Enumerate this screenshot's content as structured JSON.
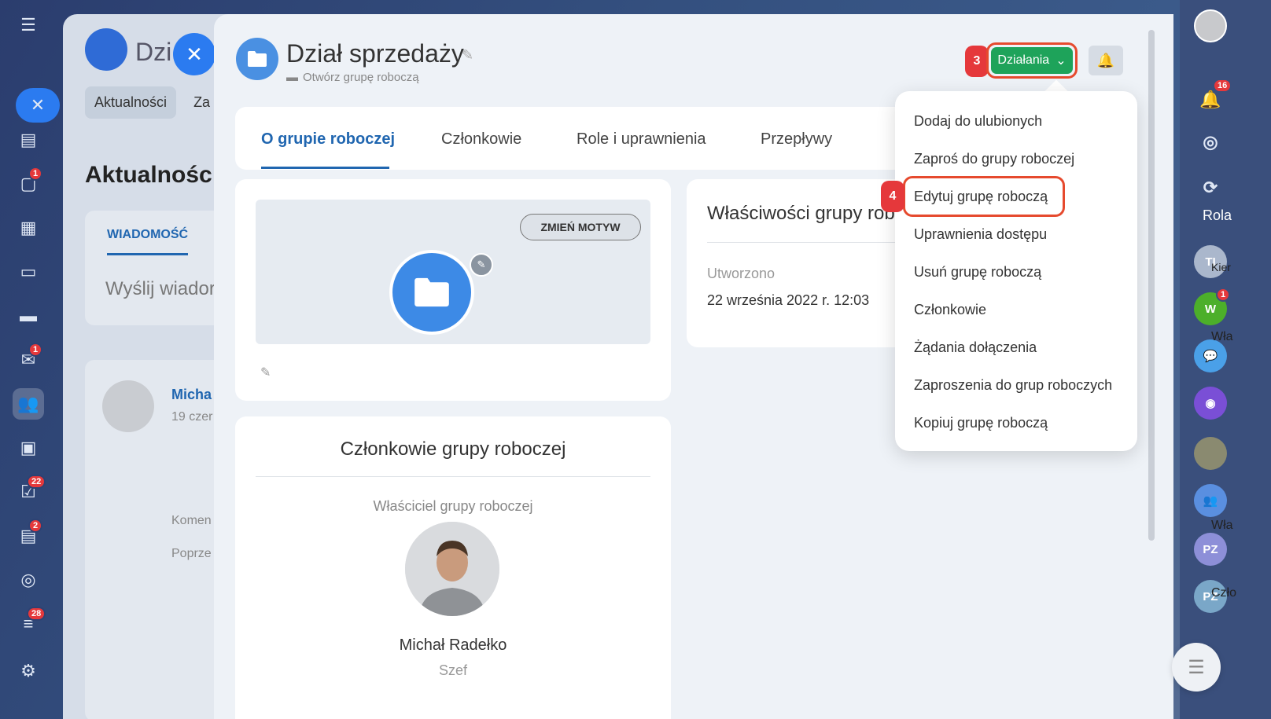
{
  "header": {
    "title": "Dział sprzedaży",
    "subtitle": "Otwórz grupę roboczą",
    "actions_label": "Działania",
    "step3": "3",
    "step4": "4"
  },
  "tabs": [
    {
      "label": "O grupie roboczej"
    },
    {
      "label": "Członkowie"
    },
    {
      "label": "Role i uprawnienia"
    },
    {
      "label": "Przepływy"
    }
  ],
  "theme": {
    "change_label": "ZMIEŃ MOTYW"
  },
  "properties": {
    "title": "Właściwości grupy rob",
    "created_label": "Utworzono",
    "created_value": "22 września 2022 r. 12:03"
  },
  "members": {
    "title": "Członkowie grupy roboczej",
    "owner_label": "Właściciel grupy roboczej",
    "owner_name": "Michał Radełko",
    "owner_role": "Szef"
  },
  "dropdown": {
    "items": [
      {
        "label": "Dodaj do ulubionych"
      },
      {
        "label": "Zaproś do grupy roboczej"
      },
      {
        "label": "Edytuj grupę roboczą"
      },
      {
        "label": "Uprawnienia dostępu"
      },
      {
        "label": "Usuń grupę roboczą"
      },
      {
        "label": "Członkowie"
      },
      {
        "label": "Żądania dołączenia"
      },
      {
        "label": "Zaproszenia do grup roboczych"
      },
      {
        "label": "Kopiuj grupę roboczą"
      }
    ]
  },
  "background": {
    "title": "Dzi",
    "tab1": "Aktualności",
    "tab2": "Za",
    "heading": "Aktualnośc",
    "message_tab": "WIADOMOŚĆ",
    "message_placeholder": "Wyślij wiador",
    "post_author": "Micha",
    "post_date": "19 czer",
    "comment": "Komen",
    "prev": "Poprze"
  },
  "leftnav_badges": {
    "chat": "1",
    "mail": "1",
    "tasks": "22",
    "crm": "2",
    "filter": "28"
  },
  "rightrail": {
    "notif_badge": "16",
    "rola": "Rola",
    "w_badge": "1",
    "kier": "Kier",
    "wla": "Wła",
    "czlo": "Czło",
    "pz": "PZ",
    "w": "W",
    "tl": "TI"
  },
  "colors": {
    "accent": "#2066b0",
    "actions_green": "#1ea35a",
    "highlight": "#e64a2e",
    "badge": "#e5383b"
  }
}
